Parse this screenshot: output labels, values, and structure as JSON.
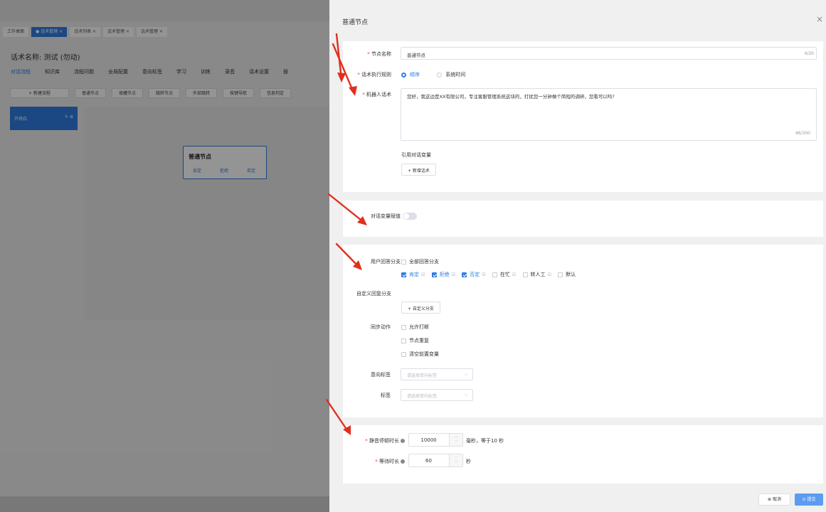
{
  "background": {
    "tabs": [
      {
        "label": "工作桌面",
        "active": false
      },
      {
        "label": "● 话术管理 ×",
        "active": true
      },
      {
        "label": "话术列表 ×",
        "active": false
      },
      {
        "label": "话术管理 ×",
        "active": false
      },
      {
        "label": "话术管理 ×",
        "active": false
      }
    ],
    "script_title": "话术名称: 测试 (勿动)",
    "nav": [
      "对话流程",
      "知识库",
      "流程问题",
      "全局配置",
      "意向标签",
      "学习",
      "训练",
      "录音",
      "话术设置",
      "操"
    ],
    "tools": [
      "+ 新建流程",
      "普通节点",
      "填槽节点",
      "跳转节点",
      "外部跳转",
      "按键导航",
      "信息判定"
    ],
    "start_node_label": "开场白",
    "start_node_icons": "✎ ⊗",
    "canvas_node": {
      "title": "普通节点",
      "branches": [
        "肯定",
        "拒绝",
        "否定"
      ]
    }
  },
  "drawer": {
    "title": "普通节点",
    "close_icon": "×",
    "node_name": {
      "label": "节点名称",
      "value": "普通节点",
      "count": "4/20"
    },
    "exec_rule": {
      "label": "话术执行规则",
      "options": [
        "顺序",
        "系统时间"
      ],
      "selected": "顺序"
    },
    "robot_script": {
      "label": "机器人话术",
      "value": "您好，我这边是XX有限公司，专注客服管理系统这块的，打扰您一分钟做个简短的调研，您看可以吗?",
      "count": "46/300"
    },
    "ref_var_label": "引用对话变量",
    "add_script_btn": "+ 新增话术",
    "var_assign": {
      "label": "对话变量赋值",
      "on": false
    },
    "reply_branch": {
      "label": "用户回答分支",
      "all_label": "全部回答分支",
      "options": [
        {
          "label": "肯定",
          "checked": true
        },
        {
          "label": "拒绝",
          "checked": true
        },
        {
          "label": "否定",
          "checked": true
        },
        {
          "label": "在忙",
          "checked": false
        },
        {
          "label": "转人工",
          "checked": false
        },
        {
          "label": "默认",
          "checked": false
        }
      ]
    },
    "custom_branch": {
      "label": "自定义回复分支",
      "btn": "+ 自定义分支"
    },
    "sync_actions": {
      "label": "同步动作",
      "options": [
        "允许打断",
        "节点重复",
        "清空前置变量"
      ]
    },
    "intent_tag": {
      "label": "意向标签",
      "placeholder": "请选择意向标签"
    },
    "tag": {
      "label": "标签",
      "placeholder": "请选择意向标签"
    },
    "silence": {
      "label": "静音停顿时长",
      "value": "10000",
      "suffix": "毫秒，等于10 秒"
    },
    "wait": {
      "label": "等待时长",
      "value": "60",
      "suffix": "秒"
    },
    "footer": {
      "cancel": "⊗ 取消",
      "submit": "⊙ 提交"
    },
    "colors": {
      "accent": "#2f7de1",
      "required": "#e53935",
      "annotation_arrow": "#e0301e"
    }
  }
}
